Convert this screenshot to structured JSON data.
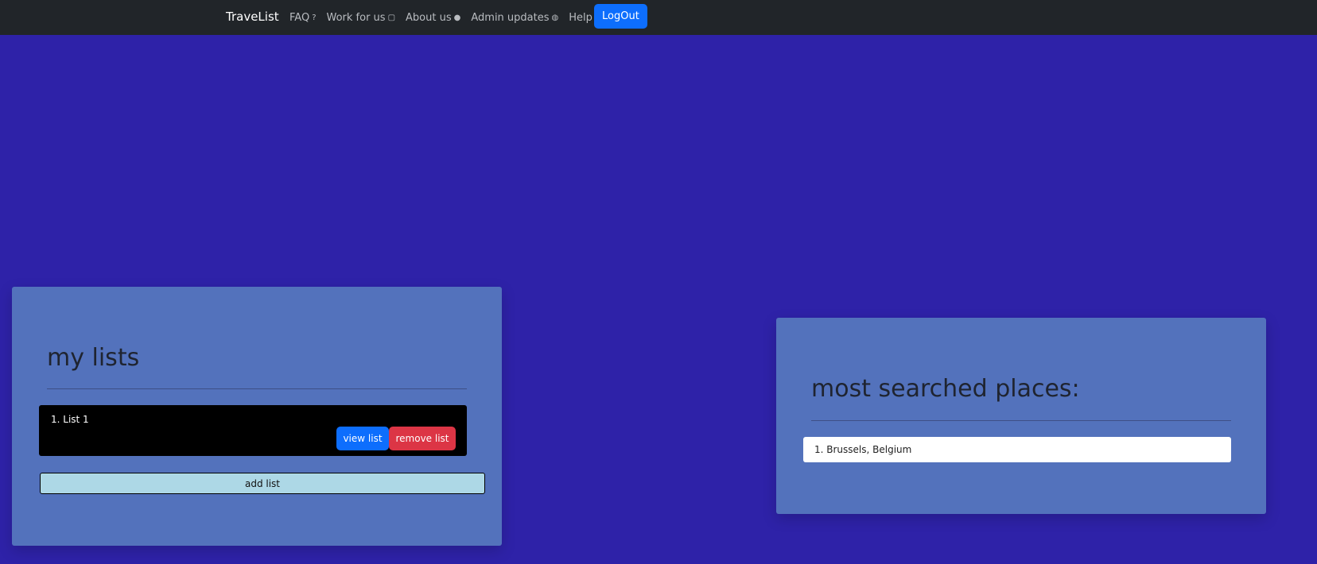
{
  "nav": {
    "brand": "TraveList",
    "links": [
      {
        "label": "FAQ",
        "icon": "question-circle-icon",
        "glyph": "?"
      },
      {
        "label": "Work for us",
        "icon": "briefcase-icon",
        "glyph": "▢"
      },
      {
        "label": "About us",
        "icon": "chat-icon",
        "glyph": "●"
      },
      {
        "label": "Admin updates",
        "icon": "globe-icon",
        "glyph": "◍"
      },
      {
        "label": "Help",
        "icon": "caret-down-icon"
      }
    ],
    "logout_label": "LogOut"
  },
  "my_lists": {
    "title": "my lists",
    "items": [
      {
        "label": "1. List 1",
        "view_label": "view list",
        "remove_label": "remove list"
      }
    ],
    "add_label": "add list"
  },
  "most_searched": {
    "title": "most searched places:",
    "items": [
      {
        "label": "1. Brussels, Belgium"
      }
    ]
  },
  "colors": {
    "background": "#2e22a8",
    "navbar": "#212529",
    "panel": "#5372bc",
    "primary": "#0d6efd",
    "danger": "#dc3545",
    "add_button": "#add8e6"
  }
}
